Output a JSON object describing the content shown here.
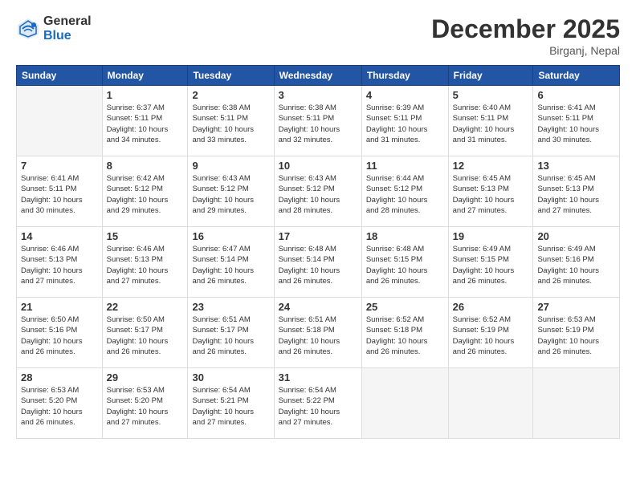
{
  "header": {
    "logo_general": "General",
    "logo_blue": "Blue",
    "month_title": "December 2025",
    "location": "Birganj, Nepal"
  },
  "days_of_week": [
    "Sunday",
    "Monday",
    "Tuesday",
    "Wednesday",
    "Thursday",
    "Friday",
    "Saturday"
  ],
  "weeks": [
    [
      {
        "day": "",
        "info": ""
      },
      {
        "day": "1",
        "info": "Sunrise: 6:37 AM\nSunset: 5:11 PM\nDaylight: 10 hours\nand 34 minutes."
      },
      {
        "day": "2",
        "info": "Sunrise: 6:38 AM\nSunset: 5:11 PM\nDaylight: 10 hours\nand 33 minutes."
      },
      {
        "day": "3",
        "info": "Sunrise: 6:38 AM\nSunset: 5:11 PM\nDaylight: 10 hours\nand 32 minutes."
      },
      {
        "day": "4",
        "info": "Sunrise: 6:39 AM\nSunset: 5:11 PM\nDaylight: 10 hours\nand 31 minutes."
      },
      {
        "day": "5",
        "info": "Sunrise: 6:40 AM\nSunset: 5:11 PM\nDaylight: 10 hours\nand 31 minutes."
      },
      {
        "day": "6",
        "info": "Sunrise: 6:41 AM\nSunset: 5:11 PM\nDaylight: 10 hours\nand 30 minutes."
      }
    ],
    [
      {
        "day": "7",
        "info": "Sunrise: 6:41 AM\nSunset: 5:11 PM\nDaylight: 10 hours\nand 30 minutes."
      },
      {
        "day": "8",
        "info": "Sunrise: 6:42 AM\nSunset: 5:12 PM\nDaylight: 10 hours\nand 29 minutes."
      },
      {
        "day": "9",
        "info": "Sunrise: 6:43 AM\nSunset: 5:12 PM\nDaylight: 10 hours\nand 29 minutes."
      },
      {
        "day": "10",
        "info": "Sunrise: 6:43 AM\nSunset: 5:12 PM\nDaylight: 10 hours\nand 28 minutes."
      },
      {
        "day": "11",
        "info": "Sunrise: 6:44 AM\nSunset: 5:12 PM\nDaylight: 10 hours\nand 28 minutes."
      },
      {
        "day": "12",
        "info": "Sunrise: 6:45 AM\nSunset: 5:13 PM\nDaylight: 10 hours\nand 27 minutes."
      },
      {
        "day": "13",
        "info": "Sunrise: 6:45 AM\nSunset: 5:13 PM\nDaylight: 10 hours\nand 27 minutes."
      }
    ],
    [
      {
        "day": "14",
        "info": "Sunrise: 6:46 AM\nSunset: 5:13 PM\nDaylight: 10 hours\nand 27 minutes."
      },
      {
        "day": "15",
        "info": "Sunrise: 6:46 AM\nSunset: 5:13 PM\nDaylight: 10 hours\nand 27 minutes."
      },
      {
        "day": "16",
        "info": "Sunrise: 6:47 AM\nSunset: 5:14 PM\nDaylight: 10 hours\nand 26 minutes."
      },
      {
        "day": "17",
        "info": "Sunrise: 6:48 AM\nSunset: 5:14 PM\nDaylight: 10 hours\nand 26 minutes."
      },
      {
        "day": "18",
        "info": "Sunrise: 6:48 AM\nSunset: 5:15 PM\nDaylight: 10 hours\nand 26 minutes."
      },
      {
        "day": "19",
        "info": "Sunrise: 6:49 AM\nSunset: 5:15 PM\nDaylight: 10 hours\nand 26 minutes."
      },
      {
        "day": "20",
        "info": "Sunrise: 6:49 AM\nSunset: 5:16 PM\nDaylight: 10 hours\nand 26 minutes."
      }
    ],
    [
      {
        "day": "21",
        "info": "Sunrise: 6:50 AM\nSunset: 5:16 PM\nDaylight: 10 hours\nand 26 minutes."
      },
      {
        "day": "22",
        "info": "Sunrise: 6:50 AM\nSunset: 5:17 PM\nDaylight: 10 hours\nand 26 minutes."
      },
      {
        "day": "23",
        "info": "Sunrise: 6:51 AM\nSunset: 5:17 PM\nDaylight: 10 hours\nand 26 minutes."
      },
      {
        "day": "24",
        "info": "Sunrise: 6:51 AM\nSunset: 5:18 PM\nDaylight: 10 hours\nand 26 minutes."
      },
      {
        "day": "25",
        "info": "Sunrise: 6:52 AM\nSunset: 5:18 PM\nDaylight: 10 hours\nand 26 minutes."
      },
      {
        "day": "26",
        "info": "Sunrise: 6:52 AM\nSunset: 5:19 PM\nDaylight: 10 hours\nand 26 minutes."
      },
      {
        "day": "27",
        "info": "Sunrise: 6:53 AM\nSunset: 5:19 PM\nDaylight: 10 hours\nand 26 minutes."
      }
    ],
    [
      {
        "day": "28",
        "info": "Sunrise: 6:53 AM\nSunset: 5:20 PM\nDaylight: 10 hours\nand 26 minutes."
      },
      {
        "day": "29",
        "info": "Sunrise: 6:53 AM\nSunset: 5:20 PM\nDaylight: 10 hours\nand 27 minutes."
      },
      {
        "day": "30",
        "info": "Sunrise: 6:54 AM\nSunset: 5:21 PM\nDaylight: 10 hours\nand 27 minutes."
      },
      {
        "day": "31",
        "info": "Sunrise: 6:54 AM\nSunset: 5:22 PM\nDaylight: 10 hours\nand 27 minutes."
      },
      {
        "day": "",
        "info": ""
      },
      {
        "day": "",
        "info": ""
      },
      {
        "day": "",
        "info": ""
      }
    ]
  ]
}
